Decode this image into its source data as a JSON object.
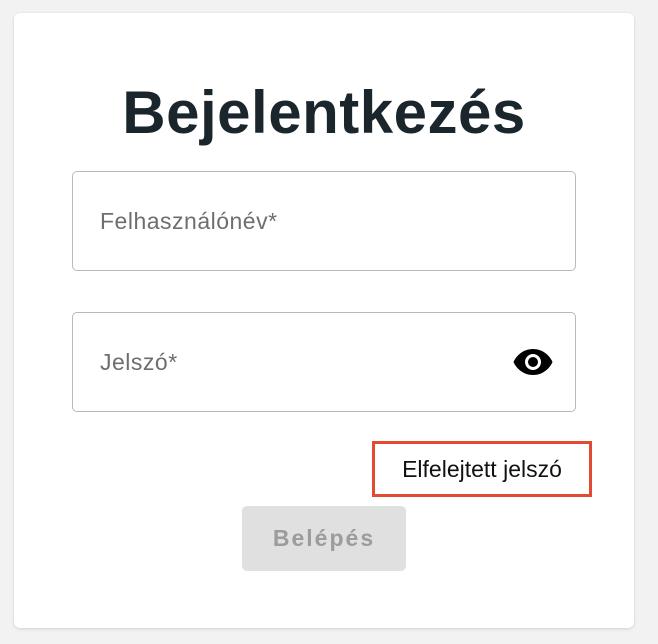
{
  "login_form": {
    "title": "Bejelentkezés",
    "username": {
      "value": "",
      "placeholder": "Felhasználónév*"
    },
    "password": {
      "value": "",
      "placeholder": "Jelszó*",
      "toggle_icon": "eye-icon"
    },
    "forgot_password_label": "Elfelejtett jelszó",
    "submit_label": "Belépés",
    "colors": {
      "highlight_border": "#e24a33",
      "title": "#1b262c",
      "button_disabled_bg": "#e0e0e0",
      "button_disabled_text": "#9c9c9c"
    }
  }
}
